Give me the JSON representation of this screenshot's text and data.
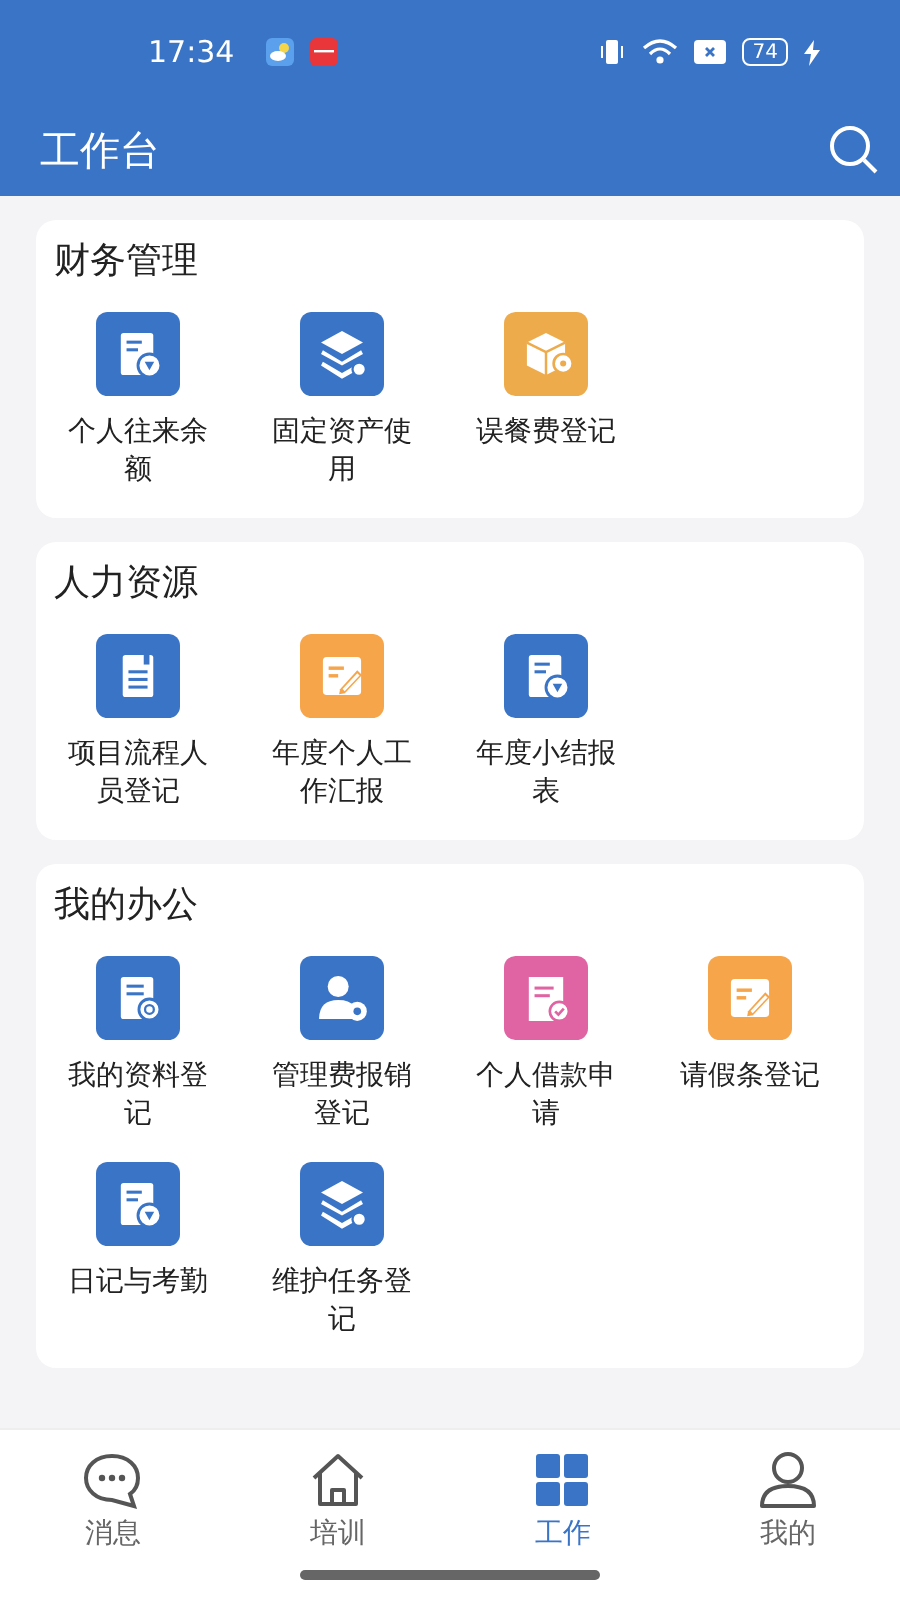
{
  "status_bar": {
    "time": "17:34",
    "battery": "74"
  },
  "header": {
    "title": "工作台"
  },
  "sections": [
    {
      "title": "财务管理",
      "items": [
        {
          "label": "个人往来余额",
          "kind": "doc-badge",
          "color": "#3a74c6"
        },
        {
          "label": "固定资产使用",
          "kind": "layers",
          "color": "#3a74c6"
        },
        {
          "label": "误餐费登记",
          "kind": "box",
          "color": "#eeab4c"
        }
      ]
    },
    {
      "title": "人力资源",
      "items": [
        {
          "label": "项目流程人员登记",
          "kind": "doc-lines",
          "color": "#3a74c6"
        },
        {
          "label": "年度个人工作汇报",
          "kind": "edit",
          "color": "#f6a54a"
        },
        {
          "label": "年度小结报表",
          "kind": "doc-badge",
          "color": "#3a74c6"
        }
      ]
    },
    {
      "title": "我的办公",
      "items": [
        {
          "label": "我的资料登记",
          "kind": "doc-search",
          "color": "#3a74c6"
        },
        {
          "label": "管理费报销登记",
          "kind": "user-gear",
          "color": "#3a74c6"
        },
        {
          "label": "个人借款申请",
          "kind": "doc-check",
          "color": "#e064a3"
        },
        {
          "label": "请假条登记",
          "kind": "edit",
          "color": "#f6a54a"
        },
        {
          "label": "日记与考勤",
          "kind": "doc-badge",
          "color": "#3a74c6"
        },
        {
          "label": "维护任务登记",
          "kind": "layers",
          "color": "#3a74c6"
        }
      ]
    }
  ],
  "tabs": [
    {
      "label": "消息",
      "kind": "chat",
      "selected": false
    },
    {
      "label": "培训",
      "kind": "home",
      "selected": false
    },
    {
      "label": "工作",
      "kind": "grid",
      "selected": true
    },
    {
      "label": "我的",
      "kind": "user",
      "selected": false
    }
  ]
}
